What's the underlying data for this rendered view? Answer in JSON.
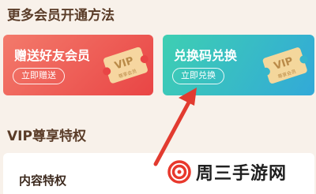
{
  "sections": {
    "more_methods_title": "更多会员开通方法",
    "vip_title": "VIP尊享特权"
  },
  "cards": {
    "gift": {
      "title": "赠送好友会员",
      "button": "立即赠送",
      "ticket_text": "VIP",
      "ticket_sub": "尊享会员"
    },
    "redeem": {
      "title": "兑换码兑换",
      "button": "立即兑换",
      "ticket_text": "VIP",
      "ticket_sub": "尊享会员"
    }
  },
  "content_panel": {
    "title": "内容特权"
  },
  "watermark": {
    "text": "周三手游网"
  },
  "colors": {
    "arrow": "#e23b30",
    "gift_card": "#e94545",
    "redeem_card": "#32a9d8"
  }
}
